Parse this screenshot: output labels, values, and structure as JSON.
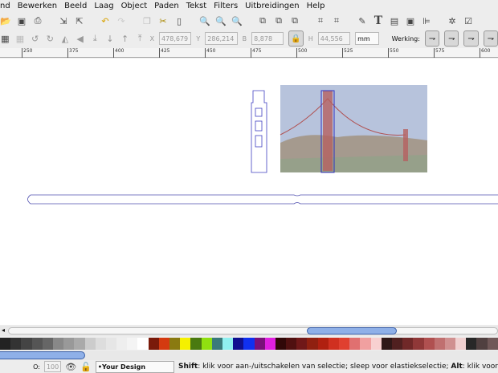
{
  "menu": [
    "nd",
    "Bewerken",
    "Beeld",
    "Laag",
    "Object",
    "Paden",
    "Tekst",
    "Filters",
    "Uitbreidingen",
    "Help"
  ],
  "toolbar": {
    "x_label": "X",
    "x": "478,679",
    "y_label": "Y",
    "y": "286,214",
    "w_label": "B",
    "w": "8,878",
    "h_label": "H",
    "h": "44,556",
    "unit": "mm",
    "werking": "Werking:"
  },
  "ruler": [
    "250",
    "375",
    "400",
    "425",
    "450",
    "475",
    "500",
    "525",
    "550",
    "575",
    "600"
  ],
  "palette": [
    "#222222",
    "#333333",
    "#444444",
    "#555555",
    "#666666",
    "#888888",
    "#999999",
    "#aaaaaa",
    "#cccccc",
    "#dddddd",
    "#e6e6e6",
    "#eeeeee",
    "#f4f4f4",
    "#ffffff",
    "#7a1a0a",
    "#d43a10",
    "#8a7a10",
    "#f5f000",
    "#4a7a10",
    "#90e010",
    "#3a7a7a",
    "#90f0f0",
    "#101090",
    "#1030f0",
    "#7a107a",
    "#e020e0",
    "#300808",
    "#501010",
    "#701818",
    "#902010",
    "#b02010",
    "#d03020",
    "#e04030",
    "#e07070",
    "#f0a0a0",
    "#f8d0d0",
    "#301818",
    "#502020",
    "#702828",
    "#903838",
    "#b05050",
    "#c07070",
    "#d09090",
    "#f0d0d0",
    "#282828",
    "#504040",
    "#705858"
  ],
  "status": {
    "opacity_label": "O:",
    "opacity": "100",
    "layer": "•Your Design",
    "shift_key": "Shift",
    "shift_text": ": klik voor aan-/uitschakelen van selectie; sleep voor elastiekselectie; ",
    "alt_key": "Alt",
    "alt_text": ": klik voor"
  }
}
